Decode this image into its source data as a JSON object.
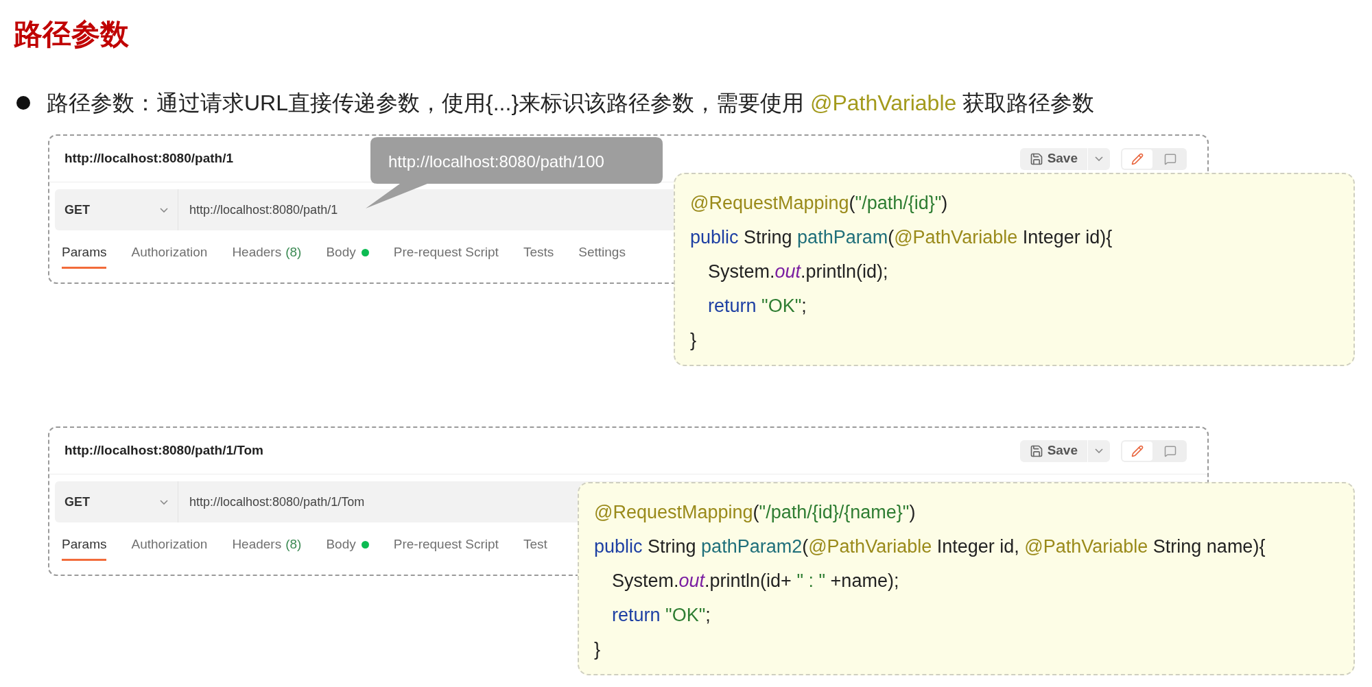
{
  "title": "路径参数",
  "bullet": [
    {
      "text": "路径参数：通过请求URL直接传递参数，使用{...}来标识该路径参数，需要使用 ",
      "kind": "plain"
    },
    {
      "text": "@PathVariable",
      "kind": "highlight"
    },
    {
      "text": " 获取路径参数",
      "kind": "plain"
    }
  ],
  "examples": [
    {
      "request": {
        "tab_title": "http://localhost:8080/path/1",
        "save": "Save",
        "method": "GET",
        "url": "http://localhost:8080/path/1",
        "tabs": [
          {
            "label": "Params",
            "selected": true
          },
          {
            "label": "Authorization",
            "selected": false
          },
          {
            "label": "Headers",
            "count": "(8)",
            "selected": false
          },
          {
            "label": "Body",
            "dot": true,
            "selected": false
          },
          {
            "label": "Pre-request Script",
            "selected": false
          },
          {
            "label": "Tests",
            "selected": false
          },
          {
            "label": "Settings",
            "selected": false
          }
        ]
      },
      "tooltip": "http://localhost:8080/path/100",
      "code": [
        {
          "indented": false,
          "tokens": [
            {
              "t": "@RequestMapping",
              "kind": "annotation"
            },
            {
              "t": "(",
              "kind": "plain"
            },
            {
              "t": "\"/path/{id}\"",
              "kind": "string"
            },
            {
              "t": ")",
              "kind": "plain"
            }
          ]
        },
        {
          "indented": false,
          "tokens": [
            {
              "t": "public",
              "kind": "keyword"
            },
            {
              "t": " String ",
              "kind": "plain"
            },
            {
              "t": "pathParam",
              "kind": "method"
            },
            {
              "t": "(",
              "kind": "plain"
            },
            {
              "t": "@PathVariable",
              "kind": "annotation"
            },
            {
              "t": " Integer id){",
              "kind": "plain"
            }
          ]
        },
        {
          "indented": true,
          "tokens": [
            {
              "t": "System.",
              "kind": "plain"
            },
            {
              "t": "out",
              "kind": "field"
            },
            {
              "t": ".println(id);",
              "kind": "plain"
            }
          ]
        },
        {
          "indented": true,
          "tokens": [
            {
              "t": "return",
              "kind": "keyword"
            },
            {
              "t": " \"OK\"",
              "kind": "string"
            },
            {
              "t": ";",
              "kind": "plain"
            }
          ]
        },
        {
          "indented": false,
          "tokens": [
            {
              "t": "}",
              "kind": "plain"
            }
          ]
        }
      ]
    },
    {
      "request": {
        "tab_title": "http://localhost:8080/path/1/Tom",
        "save": "Save",
        "method": "GET",
        "url": "http://localhost:8080/path/1/Tom",
        "tabs": [
          {
            "label": "Params",
            "selected": true
          },
          {
            "label": "Authorization",
            "selected": false
          },
          {
            "label": "Headers",
            "count": "(8)",
            "selected": false
          },
          {
            "label": "Body",
            "dot": true,
            "selected": false
          },
          {
            "label": "Pre-request Script",
            "selected": false
          },
          {
            "label": "Test",
            "selected": false
          }
        ]
      },
      "code": [
        {
          "indented": false,
          "tokens": [
            {
              "t": "@RequestMapping",
              "kind": "annotation"
            },
            {
              "t": "(",
              "kind": "plain"
            },
            {
              "t": "\"/path/{id}/{name}\"",
              "kind": "string"
            },
            {
              "t": ")",
              "kind": "plain"
            }
          ]
        },
        {
          "indented": false,
          "tokens": [
            {
              "t": "public",
              "kind": "keyword"
            },
            {
              "t": " String ",
              "kind": "plain"
            },
            {
              "t": "pathParam2",
              "kind": "method"
            },
            {
              "t": "(",
              "kind": "plain"
            },
            {
              "t": "@PathVariable",
              "kind": "annotation"
            },
            {
              "t": " Integer id, ",
              "kind": "plain"
            },
            {
              "t": "@PathVariable",
              "kind": "annotation"
            },
            {
              "t": " String name){",
              "kind": "plain"
            }
          ]
        },
        {
          "indented": true,
          "tokens": [
            {
              "t": "System.",
              "kind": "plain"
            },
            {
              "t": "out",
              "kind": "field"
            },
            {
              "t": ".println(id+ ",
              "kind": "plain"
            },
            {
              "t": "\" : \"",
              "kind": "string"
            },
            {
              "t": " +name);",
              "kind": "plain"
            }
          ]
        },
        {
          "indented": true,
          "tokens": [
            {
              "t": "return",
              "kind": "keyword"
            },
            {
              "t": " \"OK\"",
              "kind": "string"
            },
            {
              "t": ";",
              "kind": "plain"
            }
          ]
        },
        {
          "indented": false,
          "tokens": [
            {
              "t": "}",
              "kind": "plain"
            }
          ]
        }
      ]
    }
  ]
}
